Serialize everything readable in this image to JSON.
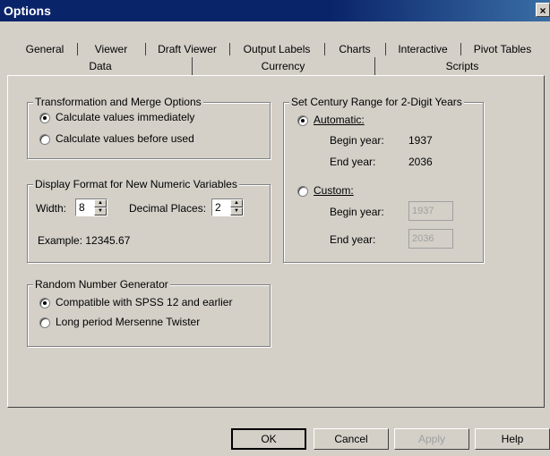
{
  "window": {
    "title": "Options",
    "close": "×"
  },
  "tabs_row1": [
    "General",
    "Viewer",
    "Draft Viewer",
    "Output Labels",
    "Charts",
    "Interactive",
    "Pivot Tables"
  ],
  "tabs_row2": [
    "Data",
    "Currency",
    "Scripts"
  ],
  "active_tab": "Data",
  "transform": {
    "legend": "Transformation and Merge Options",
    "opt1": "Calculate values immediately",
    "opt2": "Calculate values before used",
    "selected": 1
  },
  "display_format": {
    "legend": "Display Format for New Numeric Variables",
    "width_label": "Width:",
    "width_value": "8",
    "decimals_label": "Decimal Places:",
    "decimals_value": "2",
    "example": "Example:  12345.67"
  },
  "rng": {
    "legend": "Random Number Generator",
    "opt1": "Compatible with SPSS 12 and earlier",
    "opt2": "Long period Mersenne Twister",
    "selected": 1
  },
  "century": {
    "legend": "Set Century Range for 2-Digit Years",
    "automatic": "Automatic:",
    "auto_begin_label": "Begin year:",
    "auto_begin": "1937",
    "auto_end_label": "End year:",
    "auto_end": "2036",
    "custom": "Custom:",
    "custom_begin_label": "Begin year:",
    "custom_begin": "1937",
    "custom_end_label": "End year:",
    "custom_end": "2036",
    "selected": "automatic"
  },
  "buttons": {
    "ok": "OK",
    "cancel": "Cancel",
    "apply": "Apply",
    "help": "Help"
  }
}
